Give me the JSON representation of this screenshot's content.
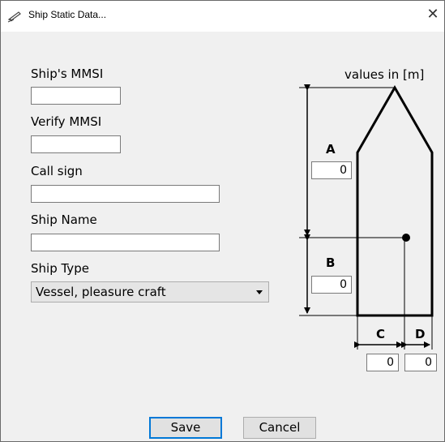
{
  "window": {
    "title": "Ship Static Data...",
    "close_glyph": "✕",
    "title_icon": "ship-icon"
  },
  "form": {
    "mmsi_label": "Ship's MMSI",
    "mmsi_value": "",
    "verify_mmsi_label": "Verify MMSI",
    "verify_mmsi_value": "",
    "call_sign_label": "Call sign",
    "call_sign_value": "",
    "ship_name_label": "Ship Name",
    "ship_name_value": "",
    "ship_type_label": "Ship Type",
    "ship_type_value": "Vessel, pleasure craft",
    "dropdown_icon": "caret-down-icon"
  },
  "diagram": {
    "units_label": "values in [m]",
    "a_label": "A",
    "a_value": "0",
    "b_label": "B",
    "b_value": "0",
    "c_label": "C",
    "c_value": "0",
    "d_label": "D",
    "d_value": "0"
  },
  "buttons": {
    "save_label": "Save",
    "cancel_label": "Cancel"
  }
}
